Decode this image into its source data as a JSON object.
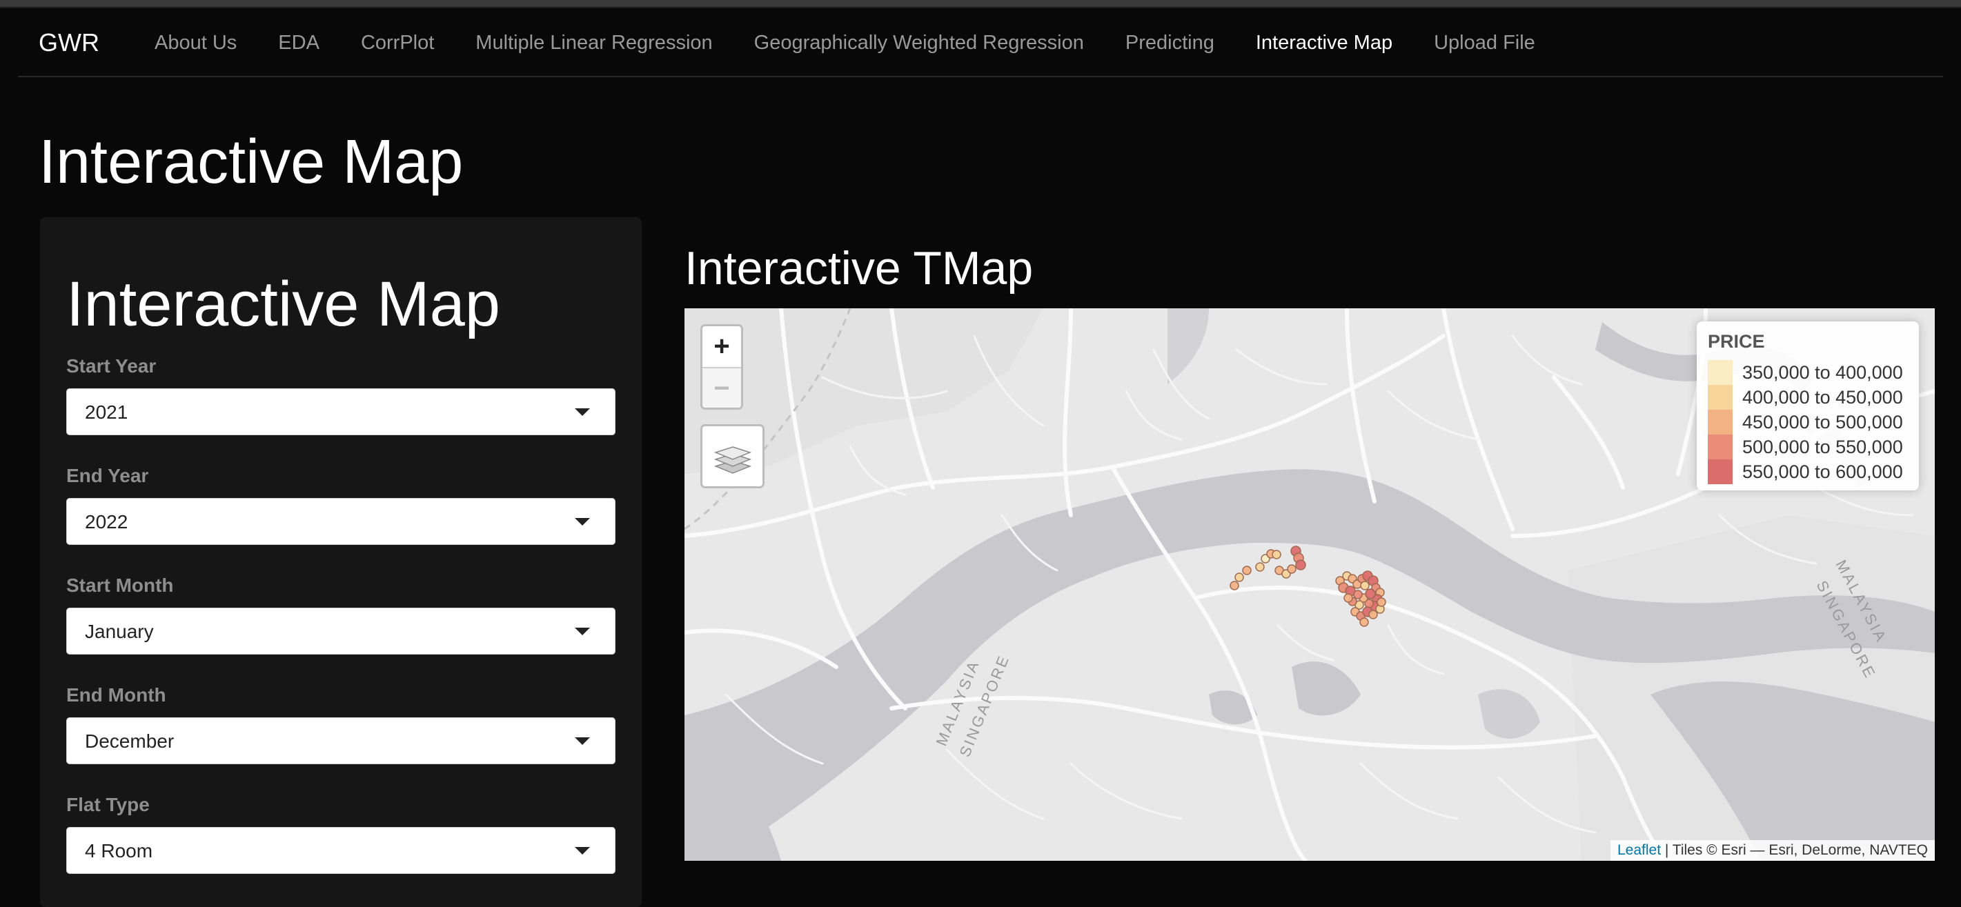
{
  "navbar": {
    "brand": "GWR",
    "links": [
      {
        "label": "About Us",
        "active": false
      },
      {
        "label": "EDA",
        "active": false
      },
      {
        "label": "CorrPlot",
        "active": false
      },
      {
        "label": "Multiple Linear Regression",
        "active": false
      },
      {
        "label": "Geographically Weighted Regression",
        "active": false
      },
      {
        "label": "Predicting",
        "active": false
      },
      {
        "label": "Interactive Map",
        "active": true
      },
      {
        "label": "Upload File",
        "active": false
      }
    ]
  },
  "page": {
    "title": "Interactive Map"
  },
  "sidebar": {
    "title": "Interactive Map",
    "fields": [
      {
        "label": "Start Year",
        "value": "2021"
      },
      {
        "label": "End Year",
        "value": "2022"
      },
      {
        "label": "Start Month",
        "value": "January"
      },
      {
        "label": "End Month",
        "value": "December"
      },
      {
        "label": "Flat Type",
        "value": "4 Room"
      }
    ]
  },
  "map": {
    "title": "Interactive TMap",
    "zoom_in": "+",
    "zoom_out": "−",
    "layers_icon": "layers-icon",
    "legend": {
      "title": "PRICE",
      "items": [
        {
          "label": "350,000 to 400,000",
          "color": "#fbedc3"
        },
        {
          "label": "400,000 to 450,000",
          "color": "#f7d49a"
        },
        {
          "label": "450,000 to 500,000",
          "color": "#f3b284"
        },
        {
          "label": "500,000 to 550,000",
          "color": "#ea8c78"
        },
        {
          "label": "550,000 to 600,000",
          "color": "#dc6d6d"
        }
      ]
    },
    "basemap_labels": {
      "left_malaysia": "MALAYSIA",
      "left_singapore": "SINGAPORE",
      "right_malaysia": "MALAYSIA",
      "right_singapore": "SINGAPORE"
    },
    "attribution": {
      "link": "Leaflet",
      "text": " | Tiles © Esri — Esri, DeLorme, NAVTEQ"
    }
  }
}
